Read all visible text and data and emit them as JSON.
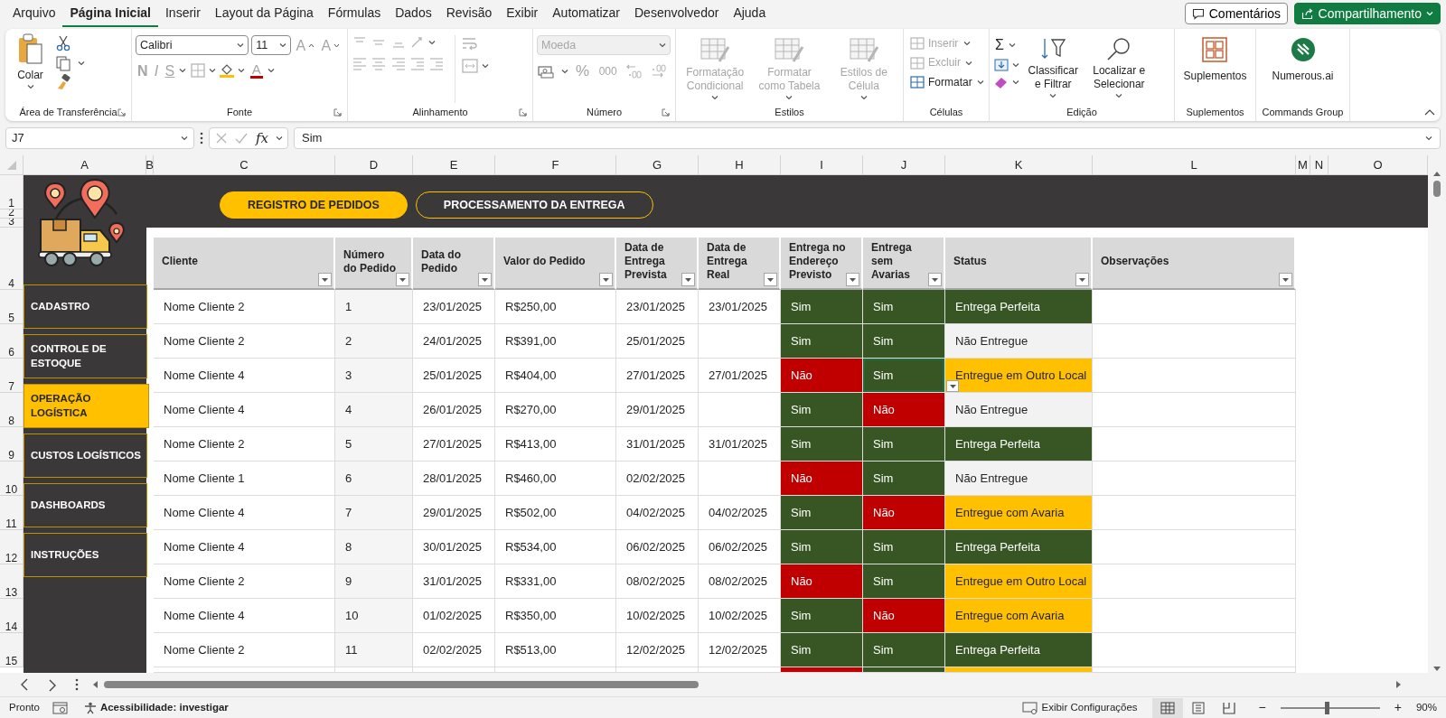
{
  "menu_tabs": [
    {
      "label": "Arquivo",
      "selected": false
    },
    {
      "label": "Página Inicial",
      "selected": true
    },
    {
      "label": "Inserir",
      "selected": false
    },
    {
      "label": "Layout da Página",
      "selected": false
    },
    {
      "label": "Fórmulas",
      "selected": false
    },
    {
      "label": "Dados",
      "selected": false
    },
    {
      "label": "Revisão",
      "selected": false
    },
    {
      "label": "Exibir",
      "selected": false
    },
    {
      "label": "Automatizar",
      "selected": false
    },
    {
      "label": "Desenvolvedor",
      "selected": false
    },
    {
      "label": "Ajuda",
      "selected": false
    }
  ],
  "header_buttons": {
    "comments": "Comentários",
    "share": "Compartilhamento"
  },
  "ribbon": {
    "clipboard": {
      "label": "Área de Transferência",
      "paste": "Colar"
    },
    "font": {
      "label": "Fonte",
      "family": "Calibri",
      "size": "11",
      "grow": "A",
      "shrink": "A",
      "font_color": "A",
      "styles": [
        {
          "text": "N",
          "disabled": true
        },
        {
          "text": "I",
          "disabled": true
        },
        {
          "text": "S",
          "disabled": true
        }
      ]
    },
    "alignment": {
      "label": "Alinhamento"
    },
    "number": {
      "label": "Número",
      "format": "Moeda",
      "format_disabled": true,
      "percent": "%",
      "thousands": "000"
    },
    "styles": {
      "label": "Estilos",
      "items": [
        {
          "label": "Formatação Condicional",
          "disabled": true
        },
        {
          "label": "Formatar como Tabela",
          "disabled": true
        },
        {
          "label": "Estilos de Célula",
          "disabled": true
        }
      ]
    },
    "cells": {
      "label": "Células",
      "items": [
        {
          "label": "Inserir",
          "disabled": true
        },
        {
          "label": "Excluir",
          "disabled": true
        },
        {
          "label": "Formatar",
          "disabled": false
        }
      ]
    },
    "editing": {
      "label": "Edição",
      "autosum": "Σ",
      "sort": "Classificar e Filtrar",
      "find": "Localizar e Selecionar"
    },
    "addins": {
      "label": "Suplementos",
      "button": "Suplementos"
    },
    "commands": {
      "label": "Commands Group",
      "button": "Numerous.ai"
    }
  },
  "formula_bar": {
    "name_box": "J7",
    "fx": "fx",
    "value": "Sim"
  },
  "column_headers": [
    "A",
    "B",
    "C",
    "D",
    "E",
    "F",
    "G",
    "H",
    "I",
    "J",
    "K",
    "L",
    "M",
    "N",
    "O"
  ],
  "row_numbers": [
    "1",
    "2",
    "3",
    "4",
    "5",
    "6",
    "7",
    "8",
    "9",
    "10",
    "11",
    "12",
    "13",
    "14",
    "15"
  ],
  "nav_tabs": [
    {
      "label": "REGISTRO DE PEDIDOS",
      "selected": true
    },
    {
      "label": "PROCESSAMENTO DA ENTREGA",
      "selected": false
    }
  ],
  "sidebar": {
    "items": [
      {
        "label": "CADASTRO",
        "selected": false
      },
      {
        "label": "CONTROLE DE ESTOQUE",
        "selected": false
      },
      {
        "label": "OPERAÇÃO LOGÍSTICA",
        "selected": true
      },
      {
        "label": "CUSTOS LOGÍSTICOS",
        "selected": false
      },
      {
        "label": "DASHBOARDS",
        "selected": false
      },
      {
        "label": "INSTRUÇÕES",
        "selected": false
      }
    ]
  },
  "table": {
    "columns": [
      "Cliente",
      "Número do Pedido",
      "Data do Pedido",
      "Valor do Pedido",
      "Data de Entrega Prevista",
      "Data de Entrega Real",
      "Entrega no Endereço Previsto",
      "Entrega sem Avarias",
      "Status",
      "Observações"
    ],
    "rows": [
      {
        "cliente": "Nome Cliente 2",
        "numero": "1",
        "data_pedido": "23/01/2025",
        "valor": "R$250,00",
        "data_prevista": "23/01/2025",
        "data_real": "23/01/2025",
        "endereco": {
          "text": "Sim",
          "ok": true
        },
        "avarias": {
          "text": "Sim",
          "ok": true,
          "selected": false
        },
        "status": {
          "text": "Entrega Perfeita",
          "color": "#375623"
        }
      },
      {
        "cliente": "Nome Cliente 2",
        "numero": "2",
        "data_pedido": "24/01/2025",
        "valor": "R$391,00",
        "data_prevista": "25/01/2025",
        "endereco": {
          "text": "Sim",
          "ok": true
        },
        "avarias": {
          "text": "Sim",
          "ok": true,
          "selected": false
        },
        "status": {
          "text": "Não Entregue",
          "color": "#f2f2f2"
        }
      },
      {
        "cliente": "Nome Cliente 4",
        "numero": "3",
        "data_pedido": "25/01/2025",
        "valor": "R$404,00",
        "data_prevista": "27/01/2025",
        "data_real": "27/01/2025",
        "endereco": {
          "text": "Não",
          "ok": false
        },
        "avarias": {
          "text": "Sim",
          "ok": true,
          "selected": true
        },
        "status": {
          "text": "Entregue em Outro Local",
          "color": "#ffc000"
        }
      },
      {
        "cliente": "Nome Cliente 4",
        "numero": "4",
        "data_pedido": "26/01/2025",
        "valor": "R$270,00",
        "data_prevista": "29/01/2025",
        "endereco": {
          "text": "Sim",
          "ok": true
        },
        "avarias": {
          "text": "Não",
          "ok": false,
          "selected": false
        },
        "status": {
          "text": "Não Entregue",
          "color": "#f2f2f2"
        }
      },
      {
        "cliente": "Nome Cliente 2",
        "numero": "5",
        "data_pedido": "27/01/2025",
        "valor": "R$413,00",
        "data_prevista": "31/01/2025",
        "data_real": "31/01/2025",
        "endereco": {
          "text": "Sim",
          "ok": true
        },
        "avarias": {
          "text": "Sim",
          "ok": true,
          "selected": false
        },
        "status": {
          "text": "Entrega Perfeita",
          "color": "#375623"
        }
      },
      {
        "cliente": "Nome Cliente 1",
        "numero": "6",
        "data_pedido": "28/01/2025",
        "valor": "R$460,00",
        "data_prevista": "02/02/2025",
        "endereco": {
          "text": "Não",
          "ok": false
        },
        "avarias": {
          "text": "Sim",
          "ok": true,
          "selected": false
        },
        "status": {
          "text": "Não Entregue",
          "color": "#f2f2f2"
        }
      },
      {
        "cliente": "Nome Cliente 4",
        "numero": "7",
        "data_pedido": "29/01/2025",
        "valor": "R$502,00",
        "data_prevista": "04/02/2025",
        "data_real": "04/02/2025",
        "endereco": {
          "text": "Sim",
          "ok": true
        },
        "avarias": {
          "text": "Não",
          "ok": false,
          "selected": false
        },
        "status": {
          "text": "Entregue com Avaria",
          "color": "#ffc000"
        }
      },
      {
        "cliente": "Nome Cliente 4",
        "numero": "8",
        "data_pedido": "30/01/2025",
        "valor": "R$534,00",
        "data_prevista": "06/02/2025",
        "data_real": "06/02/2025",
        "endereco": {
          "text": "Sim",
          "ok": true
        },
        "avarias": {
          "text": "Sim",
          "ok": true,
          "selected": false
        },
        "status": {
          "text": "Entrega Perfeita",
          "color": "#375623"
        }
      },
      {
        "cliente": "Nome Cliente 2",
        "numero": "9",
        "data_pedido": "31/01/2025",
        "valor": "R$331,00",
        "data_prevista": "08/02/2025",
        "data_real": "08/02/2025",
        "endereco": {
          "text": "Não",
          "ok": false
        },
        "avarias": {
          "text": "Sim",
          "ok": true,
          "selected": false
        },
        "status": {
          "text": "Entregue em Outro Local",
          "color": "#ffc000"
        }
      },
      {
        "cliente": "Nome Cliente 4",
        "numero": "10",
        "data_pedido": "01/02/2025",
        "valor": "R$350,00",
        "data_prevista": "10/02/2025",
        "data_real": "10/02/2025",
        "endereco": {
          "text": "Sim",
          "ok": true
        },
        "avarias": {
          "text": "Não",
          "ok": false,
          "selected": false
        },
        "status": {
          "text": "Entregue com Avaria",
          "color": "#ffc000"
        }
      },
      {
        "cliente": "Nome Cliente 2",
        "numero": "11",
        "data_pedido": "02/02/2025",
        "valor": "R$513,00",
        "data_prevista": "12/02/2025",
        "data_real": "12/02/2025",
        "endereco": {
          "text": "Sim",
          "ok": true
        },
        "avarias": {
          "text": "Sim",
          "ok": true,
          "selected": false
        },
        "status": {
          "text": "Entrega Perfeita",
          "color": "#375623"
        }
      }
    ]
  },
  "partial_row": {
    "fills": [
      {
        "color": "#c00000"
      },
      {
        "color": "#375623"
      },
      {
        "color": "#ffc000"
      }
    ]
  },
  "status_bar": {
    "ready": "Pronto",
    "accessibility": "Acessibilidade: investigar",
    "display_settings": "Exibir Configurações",
    "zoom_out": "−",
    "zoom_in": "+",
    "zoom": "90%",
    "level": 0.47
  }
}
